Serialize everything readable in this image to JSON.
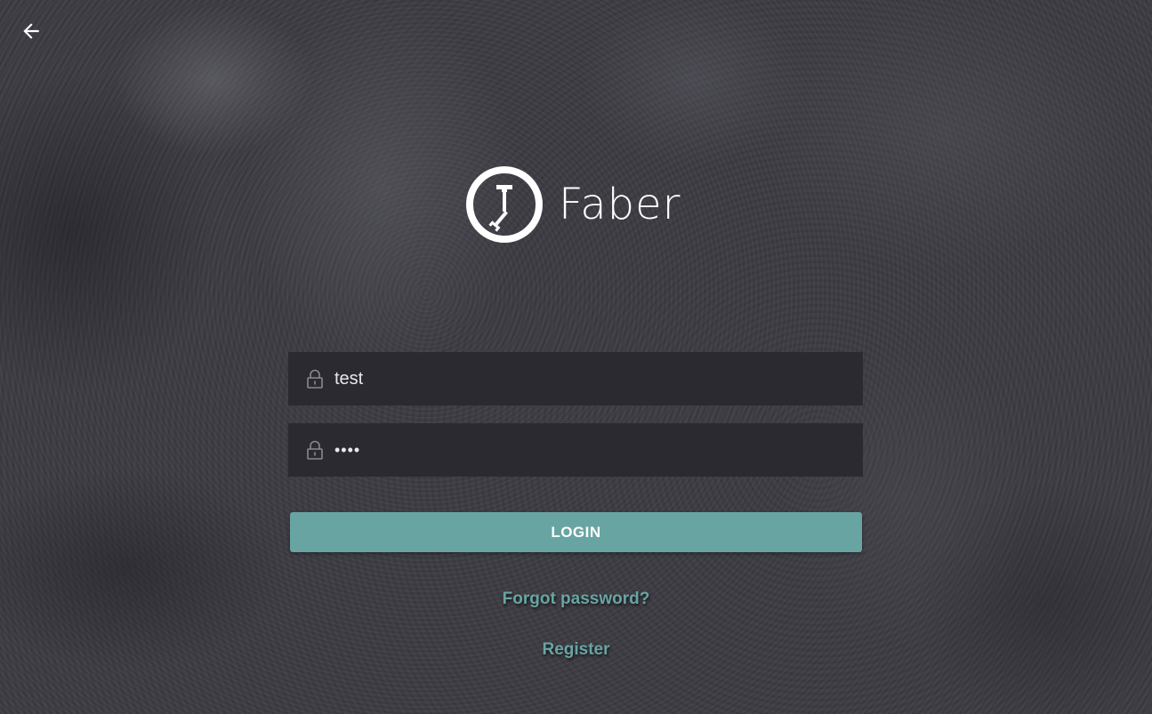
{
  "app": {
    "brand": "Faber"
  },
  "nav": {
    "back_icon": "arrow-left-icon"
  },
  "form": {
    "username": {
      "value": "test",
      "icon": "lock-icon"
    },
    "password": {
      "value": "test",
      "icon": "lock-icon"
    },
    "login_label": "LOGIN"
  },
  "links": {
    "forgot_password": "Forgot password?",
    "register": "Register"
  },
  "colors": {
    "accent": "#68a5a2",
    "field_bg": "#2b2a31",
    "background": "#3d3c43",
    "text": "#ffffff"
  }
}
